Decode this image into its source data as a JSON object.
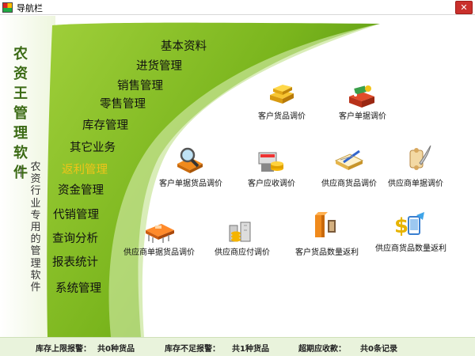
{
  "window": {
    "title": "导航栏",
    "close_label": "✕"
  },
  "brand": {
    "name": "农资王管理软件",
    "subtitle": "农资行业专用的管理软件"
  },
  "menu": [
    {
      "label": "基本资料"
    },
    {
      "label": "进货管理"
    },
    {
      "label": "销售管理"
    },
    {
      "label": "零售管理"
    },
    {
      "label": "库存管理"
    },
    {
      "label": "其它业务"
    },
    {
      "label": "返利管理",
      "active": true
    },
    {
      "label": "资金管理"
    },
    {
      "label": "代销管理"
    },
    {
      "label": "查询分析"
    },
    {
      "label": "报表统计"
    },
    {
      "label": "系统管理"
    }
  ],
  "functions": [
    {
      "label": "客户货品调价",
      "icon": "gold-bars-icon"
    },
    {
      "label": "客户单据调价",
      "icon": "red-box-icon"
    },
    {
      "label": "客户单据货品调价",
      "icon": "magnifier-icon"
    },
    {
      "label": "客户应收调价",
      "icon": "coins-icon"
    },
    {
      "label": "供应商货品调价",
      "icon": "notepad-pen-icon"
    },
    {
      "label": "供应商单据调价",
      "icon": "scroll-quill-icon"
    },
    {
      "label": "供应商单据货品调价",
      "icon": "chip-icon"
    },
    {
      "label": "供应商应付调价",
      "icon": "coin-stack-icon"
    },
    {
      "label": "客户货品数量返利",
      "icon": "pillar-icon"
    },
    {
      "label": "供应商货品数量返利",
      "icon": "dollar-mobile-icon"
    }
  ],
  "status": [
    {
      "label": "库存上限报警：",
      "value": "共0种货品"
    },
    {
      "label": "库存不足报警：",
      "value": "共1种货品"
    },
    {
      "label": "超期应收款：",
      "value": "共0条记录"
    }
  ],
  "colors": {
    "accent_green": "#7ab51d",
    "active_menu": "#f0c419",
    "brand_green": "#3b6a14"
  }
}
